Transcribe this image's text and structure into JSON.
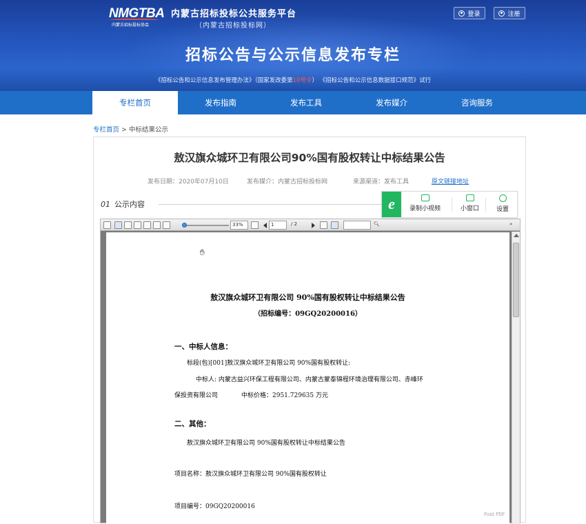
{
  "header": {
    "logo_text": "NMGTBA",
    "logo_sub": "内蒙古招标投标协会",
    "site_name": "内蒙古招标投标公共服务平台",
    "site_name_sub": "（内蒙古招标投标网）",
    "page_heading": "招标公告与公示信息发布专栏",
    "notice_pre": "《招标公告和公示信息发布管理办法》（国家发改委第",
    "notice_red": "10号令",
    "notice_post": "）  《招标公告和公示信息数据接口规范》试行",
    "login_label": "登录",
    "register_label": "注册"
  },
  "nav": {
    "items": [
      {
        "label": "专栏首页",
        "active": true
      },
      {
        "label": "发布指南",
        "active": false
      },
      {
        "label": "发布工具",
        "active": false
      },
      {
        "label": "发布媒介",
        "active": false
      },
      {
        "label": "咨询服务",
        "active": false
      }
    ]
  },
  "breadcrumb": {
    "home": "专栏首页",
    "sep": ">",
    "current": "中标结果公示"
  },
  "article": {
    "title": "敖汉旗众城环卫有限公司90%国有股权转让中标结果公告",
    "publish_date": "发布日期：2020年07月10日",
    "publish_media": "发布媒介：内蒙古招标投标网",
    "source_channel": "来源渠道：发布工具",
    "original_link": "原文链接地址",
    "section_num": "01",
    "section_label": "公示内容"
  },
  "recorder": {
    "logo": "e",
    "record_label": "录制小视频",
    "window_label": "小窗口",
    "settings_label": "设置"
  },
  "viewer": {
    "zoom": "33%",
    "page_current": "1",
    "page_total": "/ 2"
  },
  "document": {
    "title": "敖汉旗众城环卫有限公司 90%国有股权转让中标结果公告",
    "code": "（招标编号：09GQ20200016）",
    "h1": "一、中标人信息：",
    "p1": "标段(包)[001]敖汉旗众城环卫有限公司 90%国有股权转让:",
    "p2": "中标人: 内蒙古益兴环保工程有限公司、内蒙古蒙泰锦程环境治理有限公司、赤峰环",
    "p3a": "保投资有限公司",
    "p3b": "中标价格：2951.729635 万元",
    "h2": "二、其他：",
    "p4": "敖汉旗众城环卫有限公司 90%国有股权转让中标结果公告",
    "p5": "项目名称：敖汉旗众城环卫有限公司 90%国有股权转让",
    "p6": "项目编号：09GQ20200016",
    "watermark": "Foxit PDF"
  }
}
